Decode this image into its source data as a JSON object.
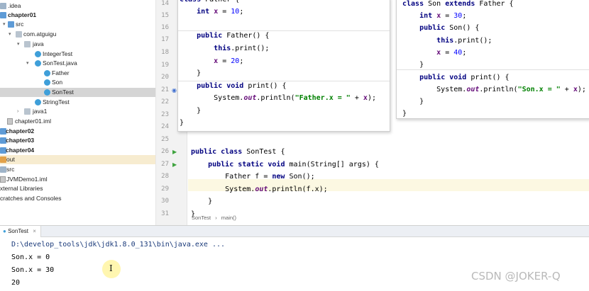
{
  "project_tree": {
    "items": [
      {
        "label": ".idea",
        "depth": 0,
        "icon": "folder-icon",
        "bold": false
      },
      {
        "label": "chapter01",
        "depth": 0,
        "icon": "module-folder-icon",
        "bold": true
      },
      {
        "label": "src",
        "depth": 1,
        "icon": "source-folder-icon",
        "bold": false
      },
      {
        "label": "com.atguigu",
        "depth": 2,
        "icon": "package-icon",
        "bold": false
      },
      {
        "label": "java",
        "depth": 3,
        "icon": "package-icon",
        "bold": false
      },
      {
        "label": "IntegerTest",
        "depth": 4,
        "icon": "java-class-icon",
        "bold": false
      },
      {
        "label": "SonTest.java",
        "depth": 4,
        "icon": "java-file-icon",
        "bold": false
      },
      {
        "label": "Father",
        "depth": 5,
        "icon": "java-class-icon",
        "bold": false
      },
      {
        "label": "Son",
        "depth": 5,
        "icon": "java-class-icon",
        "bold": false
      },
      {
        "label": "SonTest",
        "depth": 5,
        "icon": "java-class-icon",
        "bold": false
      },
      {
        "label": "StringTest",
        "depth": 4,
        "icon": "java-class-icon",
        "bold": false
      },
      {
        "label": "java1",
        "depth": 3,
        "icon": "package-icon",
        "bold": false
      },
      {
        "label": "chapter01.iml",
        "depth": 1,
        "icon": "iml-file-icon",
        "bold": false
      },
      {
        "label": "chapter02",
        "depth": 0,
        "icon": "module-folder-icon",
        "bold": true
      },
      {
        "label": "chapter03",
        "depth": 0,
        "icon": "module-folder-icon",
        "bold": true
      },
      {
        "label": "chapter04",
        "depth": 0,
        "icon": "module-folder-icon",
        "bold": true
      },
      {
        "label": "out",
        "depth": 0,
        "icon": "output-folder-icon",
        "bold": false
      },
      {
        "label": "src",
        "depth": 0,
        "icon": "source-folder-icon",
        "bold": false
      },
      {
        "label": "JVMDemo1.iml",
        "depth": 0,
        "icon": "iml-file-icon",
        "bold": false
      },
      {
        "label": "xternal Libraries",
        "depth": 0,
        "icon": "",
        "bold": false
      },
      {
        "label": "cratches and Consoles",
        "depth": 0,
        "icon": "",
        "bold": false
      }
    ],
    "selected": "SonTest"
  },
  "editor": {
    "file_tab": "SonTest.java",
    "current_line": "29",
    "lines": [
      {
        "num": "25",
        "code": ""
      },
      {
        "num": "26",
        "code": "public class SonTest {"
      },
      {
        "num": "27",
        "code": "    public static void main(String[] args) {"
      },
      {
        "num": "28",
        "code": "        Father f = new Son();"
      },
      {
        "num": "29",
        "code": "        System.out.println(f.x);"
      },
      {
        "num": "30",
        "code": "    }"
      },
      {
        "num": "31",
        "code": "}"
      }
    ],
    "breadcrumb": [
      "SonTest",
      "main()"
    ],
    "breadcrumb_sep": "›"
  },
  "father_popup": {
    "first_line_partial": "class Father {",
    "lines": [
      {
        "num": "14",
        "code": "class Father {"
      },
      {
        "num": "15",
        "code": "    int x = 10;"
      },
      {
        "num": "16",
        "code": ""
      },
      {
        "num": "17",
        "code": "    public Father() {"
      },
      {
        "num": "18",
        "code": "        this.print();"
      },
      {
        "num": "19",
        "code": "        x = 20;"
      },
      {
        "num": "20",
        "code": "    }"
      },
      {
        "num": "21",
        "code": "    public void print() {"
      },
      {
        "num": "22",
        "code": "        System.out.println(\"Father.x = \" + x);"
      },
      {
        "num": "23",
        "code": "    }"
      },
      {
        "num": "24",
        "code": "}"
      }
    ]
  },
  "son_popup": {
    "lines": [
      {
        "code": "class Son extends Father {"
      },
      {
        "code": "    int x = 30;"
      },
      {
        "code": "    public Son() {"
      },
      {
        "code": "        this.print();"
      },
      {
        "code": "        x = 40;"
      },
      {
        "code": "    }"
      },
      {
        "code": "    public void print() {"
      },
      {
        "code": "        System.out.println(\"Son.x = \" + x);"
      },
      {
        "code": "    }"
      },
      {
        "code": "}"
      }
    ]
  },
  "run_panel": {
    "tab_label": "SonTest",
    "close_glyph": "×",
    "command": "D:\\develop_tools\\jdk\\jdk1.8.0_131\\bin\\java.exe ...",
    "output": [
      "Son.x = 0",
      "Son.x = 30",
      "20"
    ]
  },
  "watermark": "CSDN @JOKER-Q",
  "colors": {
    "keyword": "#000080",
    "field": "#660e7a",
    "number": "#0000ff",
    "string": "#008000",
    "selection": "#d5d5d5",
    "current_line": "#fcf8e2",
    "run_arrow": "#3fa33f"
  }
}
